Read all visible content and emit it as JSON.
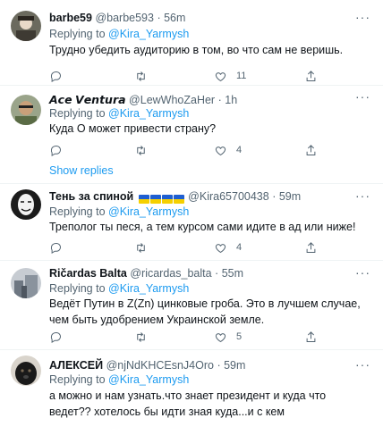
{
  "tweets": [
    {
      "name": "barbe59",
      "handle": "@barbe593",
      "dot": "·",
      "time": "56m",
      "more": "···",
      "replying_prefix": "Replying to ",
      "replying_to": "@Kira_Yarmysh",
      "text": "Трудно убедить аудиторию в том, во что сам не веришь.",
      "replies": "",
      "retweets": "",
      "likes": "11",
      "avatar_icon": "avatar-photo"
    },
    {
      "name": "𝘼𝙘𝙚 𝙑𝙚𝙣𝙩𝙪𝙧𝙖",
      "handle": "@LewWhoZaHer",
      "dot": "·",
      "time": "1h",
      "more": "···",
      "replying_prefix": "Replying to ",
      "replying_to": "@Kira_Yarmysh",
      "text": "Куда О может привести страну?",
      "replies": "",
      "retweets": "",
      "likes": "4",
      "avatar_icon": "avatar-photo"
    },
    {
      "name": "Тень за спиной",
      "name_flags": [
        "ukraine-flag",
        "ukraine-flag",
        "ukraine-flag",
        "ukraine-flag"
      ],
      "handle": "@Kira65700438",
      "dot": "·",
      "time": "59m",
      "more": "···",
      "replying_prefix": "Replying to ",
      "replying_to": "@Kira_Yarmysh",
      "text": "Треполог ты песя, а тем курсом сами идите в ад или ниже!",
      "replies": "",
      "retweets": "",
      "likes": "4",
      "avatar_icon": "avatar-mask"
    },
    {
      "name": "Ričardas Balta",
      "handle": "@ricardas_balta",
      "dot": "·",
      "time": "55m",
      "more": "···",
      "replying_prefix": "Replying to ",
      "replying_to": "@Kira_Yarmysh",
      "text": "Ведёт Путин в Z(Zn) цинковые гроба. Это в лучшем случае, чем быть удобрением Украинской земле.",
      "replies": "",
      "retweets": "",
      "likes": "5",
      "avatar_icon": "avatar-photo"
    },
    {
      "name": "АЛЕКСЕЙ",
      "handle": "@njNdKHCEsnJ4Oro",
      "dot": "·",
      "time": "59m",
      "more": "···",
      "replying_prefix": "Replying to ",
      "replying_to": "@Kira_Yarmysh",
      "text": "а можно и нам узнать.что знает президент и куда что ведет?? хотелось бы идти зная куда...и с кем",
      "avatar_icon": "avatar-dog"
    }
  ],
  "show_replies": "Show replies",
  "colors": {
    "link": "#1d9bf0",
    "muted": "#536471",
    "text": "#0f1419",
    "divider": "#eff3f4"
  }
}
